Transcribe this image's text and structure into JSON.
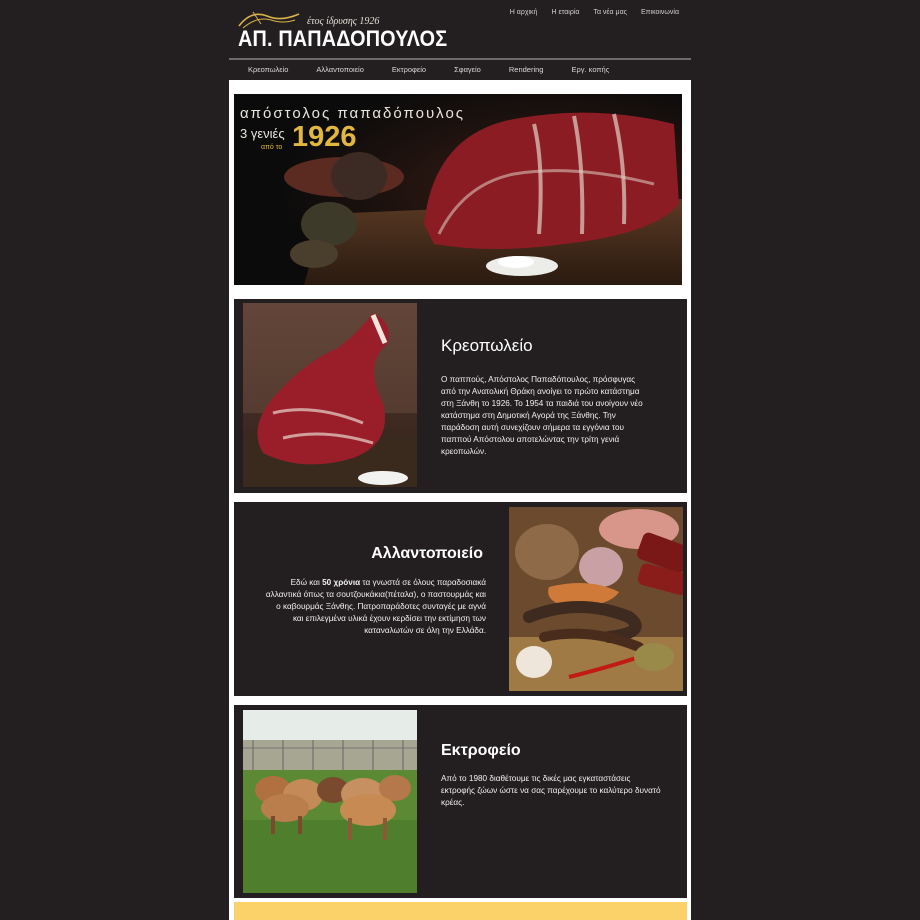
{
  "header": {
    "logo_subtitle": "έτος ίδρυσης 1926",
    "logo_name": "ΑΠ. ΠΑΠΑΔΟΠΟΥΛΟΣ",
    "top_nav": [
      "Η αρχική",
      "Η εταιρία",
      "Τα νέα μας",
      "Επικοινωνία"
    ]
  },
  "main_nav": [
    "Κρεοπωλείο",
    "Αλλαντοποιείο",
    "Εκτροφείο",
    "Σφαγείο",
    "Rendering",
    "Εργ. κοπής"
  ],
  "hero": {
    "title": "απόστολος παπαδόπουλος",
    "generations": "3 γενιές",
    "since": "από το",
    "year": "1926"
  },
  "sections": [
    {
      "title": "Κρεοπωλείο",
      "text": "Ο παππούς, Απόστολος Παπαδόπουλος, πρόσφυγας από την Ανατολική Θράκη ανοίγει το πρώτο κατάστημα στη Ξάνθη το 1926. Το 1954 τα παιδιά του ανοίγουν νέο κατάστημα στη Δημοτική Αγορά της Ξάνθης. Την παράδοση αυτή συνεχίζουν σήμερα τα εγγόνια του παππού Απόστολου αποτελώντας την τρίτη γενιά κρεοπωλών."
    },
    {
      "title": "Αλλαντοποιείο",
      "text_before": "Εδώ και ",
      "text_bold": "50 χρόνια",
      "text_after": " τα γνωστά σε όλους παραδοσιακά αλλαντικά όπως τα σουτζουκάκια(πέταλα), ο παστουρμάς και ο καβουρμάς Ξάνθης. Πατροπαράδοτες συνταγές με αγνά και επιλεγμένα υλικά έχουν κερδίσει την εκτίμηση των καταναλωτών σε όλη την Ελλάδα."
    },
    {
      "title": "Εκτροφείο",
      "text": "Από το 1980 διαθέτουμε τις δικές μας εγκαταστάσεις εκτροφής ζώων ώστε να σας παρέχουμε το καλύτερο δυνατό κρέας."
    }
  ],
  "colors": {
    "background": "#231f20",
    "gold": "#e1b742",
    "footer_band": "#fbd26a"
  }
}
